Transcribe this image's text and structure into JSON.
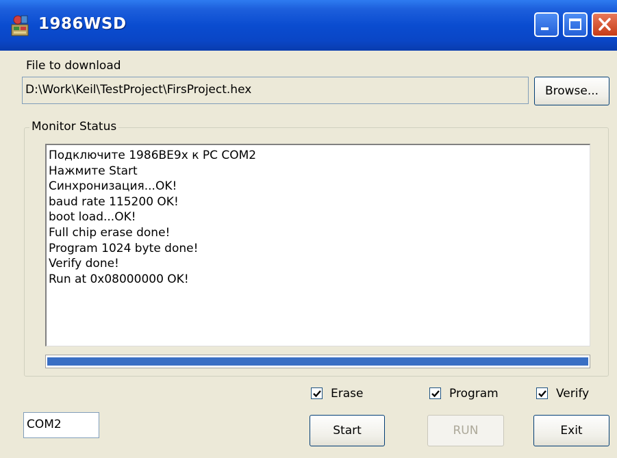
{
  "window": {
    "title": "1986WSD"
  },
  "file": {
    "label": "File to download",
    "path": "D:\\Work\\Keil\\TestProject\\FirsProject.hex",
    "browse_label": "Browse..."
  },
  "monitor": {
    "label": "Monitor Status",
    "lines": [
      "Подключите 1986BE9x к PC COM2",
      "Нажмите Start",
      "Синхронизация...OK!",
      "baud rate 115200 OK!",
      "boot load...OK!",
      "Full chip erase done!",
      "Program 1024 byte done!",
      "Verify done!",
      "Run at 0x08000000 OK!"
    ],
    "progress": 1.0,
    "progress_color": "#3a6fc4"
  },
  "options": {
    "erase": {
      "label": "Erase",
      "checked": true
    },
    "program": {
      "label": "Program",
      "checked": true
    },
    "verify": {
      "label": "Verify",
      "checked": true
    }
  },
  "port": {
    "value": "COM2"
  },
  "buttons": {
    "start": "Start",
    "run": "RUN",
    "exit": "Exit"
  },
  "colors": {
    "titlebar": "#0a4cd0",
    "window_bg": "#ece9d8",
    "close": "#c63c16"
  },
  "icons": {
    "app": "installer-icon",
    "min": "minimize-icon",
    "max": "maximize-icon",
    "close": "close-icon"
  }
}
